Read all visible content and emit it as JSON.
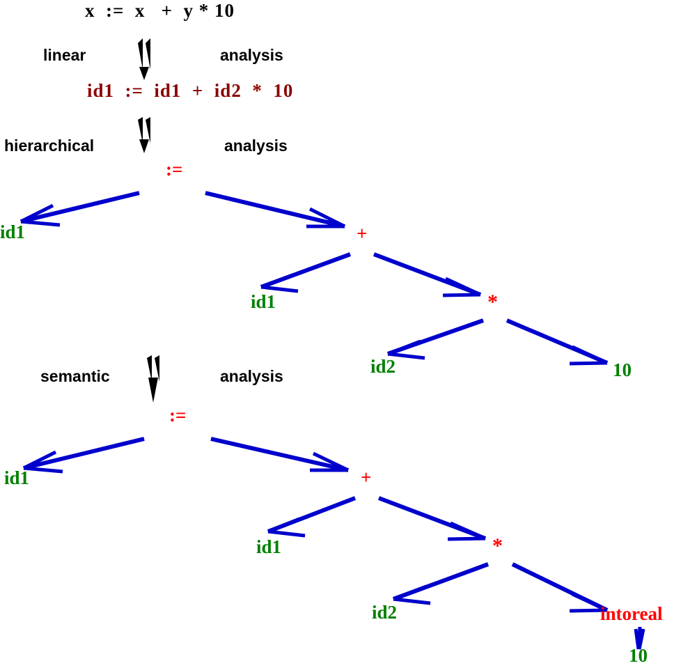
{
  "diagram": {
    "title": "Compiler phases: linear, hierarchical and semantic analysis of x := x + y * 10",
    "colors": {
      "source_text": "#000000",
      "token_text": "#8b0000",
      "operator_node": "#ff0000",
      "leaf_node": "#008000",
      "cast_node": "#ff0000",
      "edge": "#0000cc",
      "phase_arrow": "#000000",
      "background": "#ffffff"
    }
  },
  "source": {
    "label": "x  :=  x   +  y * 10"
  },
  "phases": [
    {
      "left": "linear",
      "right": "analysis"
    },
    {
      "left": "hierarchical",
      "right": "analysis"
    },
    {
      "left": "semantic",
      "right": "analysis"
    }
  ],
  "tokens": {
    "label": "id1  :=  id1  +  id2  *  10"
  },
  "syntax_tree": {
    "name": "hierarchical-parse-tree",
    "nodes": [
      {
        "id": "assign",
        "label": ":=",
        "kind": "operator"
      },
      {
        "id": "id1-left",
        "label": "id1",
        "kind": "leaf"
      },
      {
        "id": "plus",
        "label": "+",
        "kind": "operator"
      },
      {
        "id": "id1-right",
        "label": "id1",
        "kind": "leaf"
      },
      {
        "id": "times",
        "label": "*",
        "kind": "operator"
      },
      {
        "id": "id2",
        "label": "id2",
        "kind": "leaf"
      },
      {
        "id": "ten",
        "label": "10",
        "kind": "leaf"
      }
    ],
    "edges": [
      [
        "assign",
        "id1-left"
      ],
      [
        "assign",
        "plus"
      ],
      [
        "plus",
        "id1-right"
      ],
      [
        "plus",
        "times"
      ],
      [
        "times",
        "id2"
      ],
      [
        "times",
        "ten"
      ]
    ]
  },
  "semantic_tree": {
    "name": "semantic-annotated-tree",
    "nodes": [
      {
        "id": "assign2",
        "label": ":=",
        "kind": "operator"
      },
      {
        "id": "id1-left2",
        "label": "id1",
        "kind": "leaf"
      },
      {
        "id": "plus2",
        "label": "+",
        "kind": "operator"
      },
      {
        "id": "id1-right2",
        "label": "id1",
        "kind": "leaf"
      },
      {
        "id": "times2",
        "label": "*",
        "kind": "operator"
      },
      {
        "id": "id2b",
        "label": "id2",
        "kind": "leaf"
      },
      {
        "id": "intoreal",
        "label": "intoreal",
        "kind": "cast"
      },
      {
        "id": "ten2",
        "label": "10",
        "kind": "leaf"
      }
    ],
    "edges": [
      [
        "assign2",
        "id1-left2"
      ],
      [
        "assign2",
        "plus2"
      ],
      [
        "plus2",
        "id1-right2"
      ],
      [
        "plus2",
        "times2"
      ],
      [
        "times2",
        "id2b"
      ],
      [
        "times2",
        "intoreal"
      ],
      [
        "intoreal",
        "ten2"
      ]
    ]
  }
}
